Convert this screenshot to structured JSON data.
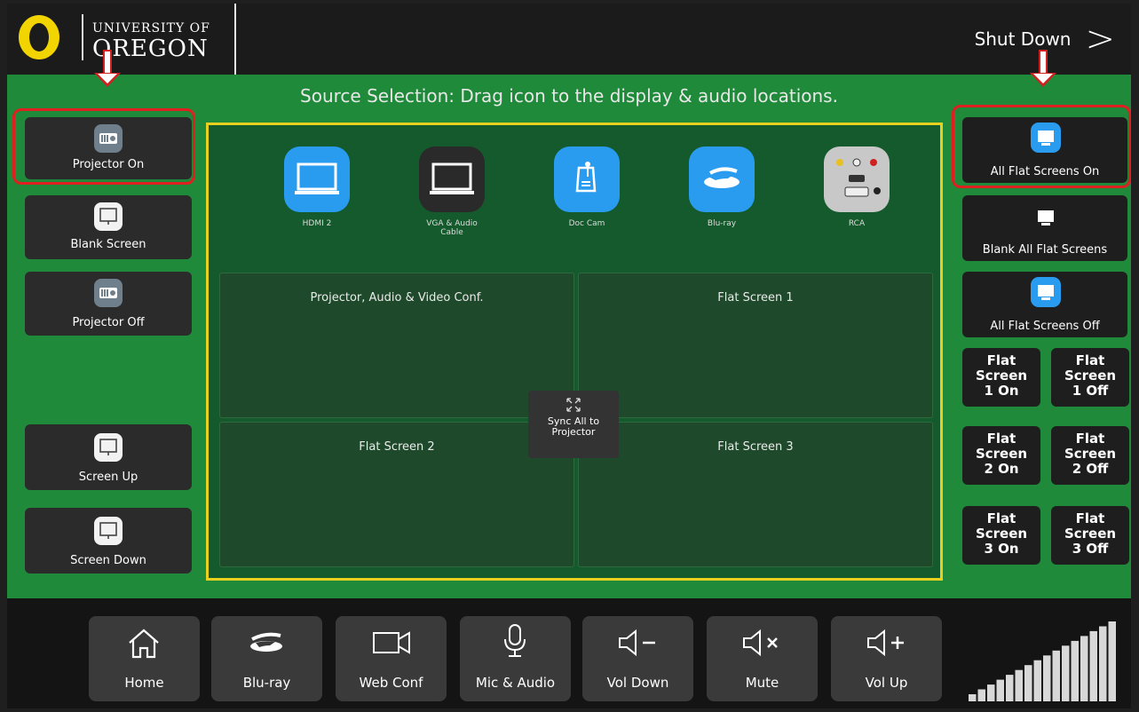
{
  "header": {
    "logo_line1": "UNIVERSITY OF",
    "logo_line2": "OREGON",
    "shutdown_label": "Shut Down",
    "shutdown_chevron": ">"
  },
  "title": "Source Selection: Drag icon to the display & audio locations.",
  "left_buttons": [
    {
      "label": "Projector On",
      "icon": "projector-icon"
    },
    {
      "label": "Blank Screen",
      "icon": "screen-icon"
    },
    {
      "label": "Projector Off",
      "icon": "projector-icon"
    },
    {
      "label": "Screen Up",
      "icon": "screen-icon"
    },
    {
      "label": "Screen Down",
      "icon": "screen-icon"
    }
  ],
  "right_buttons": [
    {
      "label": "All Flat Screens On",
      "icon": "monitor-icon"
    },
    {
      "label": "Blank All Flat Screens",
      "icon": "monitor-icon"
    },
    {
      "label": "All Flat Screens Off",
      "icon": "monitor-icon"
    }
  ],
  "flat_buttons": [
    {
      "line1": "Flat",
      "line2": "Screen",
      "line3": "1 On"
    },
    {
      "line1": "Flat",
      "line2": "Screen",
      "line3": "1 Off"
    },
    {
      "line1": "Flat",
      "line2": "Screen",
      "line3": "2 On"
    },
    {
      "line1": "Flat",
      "line2": "Screen",
      "line3": "2 Off"
    },
    {
      "line1": "Flat",
      "line2": "Screen",
      "line3": "3 On"
    },
    {
      "line1": "Flat",
      "line2": "Screen",
      "line3": "3 Off"
    }
  ],
  "sources": [
    {
      "label": "HDMI 2",
      "icon": "laptop-icon",
      "color": "#2a9cf0"
    },
    {
      "label": "VGA & Audio Cable",
      "icon": "laptop-icon",
      "color": "#2a2a2a"
    },
    {
      "label": "Doc Cam",
      "icon": "doc-cam-icon",
      "color": "#2a9cf0"
    },
    {
      "label": "Blu-ray",
      "icon": "bluray-icon",
      "color": "#2a9cf0"
    },
    {
      "label": "RCA",
      "icon": "rca-icon",
      "color": "#c8c8c8"
    }
  ],
  "zones": [
    {
      "label": "Projector, Audio & Video Conf."
    },
    {
      "label": "Flat Screen 1"
    },
    {
      "label": "Flat Screen 2"
    },
    {
      "label": "Flat Screen 3"
    }
  ],
  "sync": {
    "line1": "Sync All to",
    "line2": "Projector",
    "icon": "expand-icon"
  },
  "bottom_buttons": [
    {
      "label": "Home",
      "icon": "home-icon"
    },
    {
      "label": "Blu-ray",
      "icon": "bluray-icon"
    },
    {
      "label": "Web Conf",
      "icon": "video-camera-icon"
    },
    {
      "label": "Mic & Audio",
      "icon": "microphone-icon"
    },
    {
      "label": "Vol Down",
      "icon": "volume-down-icon"
    },
    {
      "label": "Mute",
      "icon": "mute-icon"
    },
    {
      "label": "Vol Up",
      "icon": "volume-up-icon"
    }
  ],
  "volume": {
    "bars": 16,
    "level": 1.0
  },
  "colors": {
    "background": "#1f8a3a",
    "highlight": "#e02020",
    "stage_border": "#e8d020",
    "accent": "#2a9cf0",
    "oregon_yellow": "#f2d400"
  }
}
